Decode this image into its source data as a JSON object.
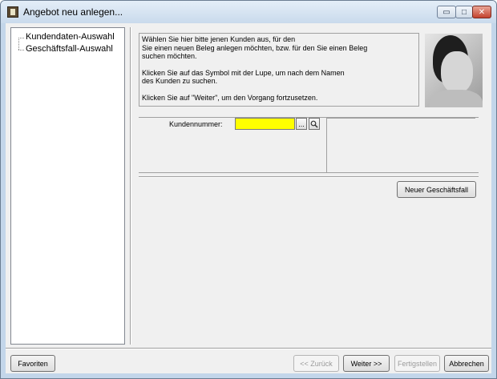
{
  "window": {
    "title": "Angebot neu anlegen..."
  },
  "caption_buttons": {
    "minimize": "▭",
    "maximize": "□",
    "close": "✕"
  },
  "tree": {
    "items": [
      "Kundendaten-Auswahl",
      "Geschäftsfall-Auswahl"
    ]
  },
  "info": {
    "para1_line1": "Wählen Sie hier bitte jenen Kunden aus, für den",
    "para1_line2": "Sie einen neuen Beleg anlegen möchten, bzw. für den Sie einen Beleg",
    "para1_line3": "suchen möchten.",
    "para2_line1": "Klicken Sie auf das Symbol mit der Lupe, um nach dem Namen",
    "para2_line2": "des Kunden zu suchen.",
    "para3_line1": "Klicken Sie auf \"Weiter\", um den Vorgang fortzusetzen."
  },
  "form": {
    "kundennummer_label": "Kundennummer:",
    "kundennummer_value": "",
    "ellipsis_button": "...",
    "input_color": "#ffff00"
  },
  "buttons": {
    "neuer_geschaeftsfall": "Neuer Geschäftsfall",
    "favoriten": "Favoriten",
    "zurueck": "<< Zurück",
    "weiter": "Weiter >>",
    "fertigstellen": "Fertigstellen",
    "abbrechen": "Abbrechen"
  }
}
